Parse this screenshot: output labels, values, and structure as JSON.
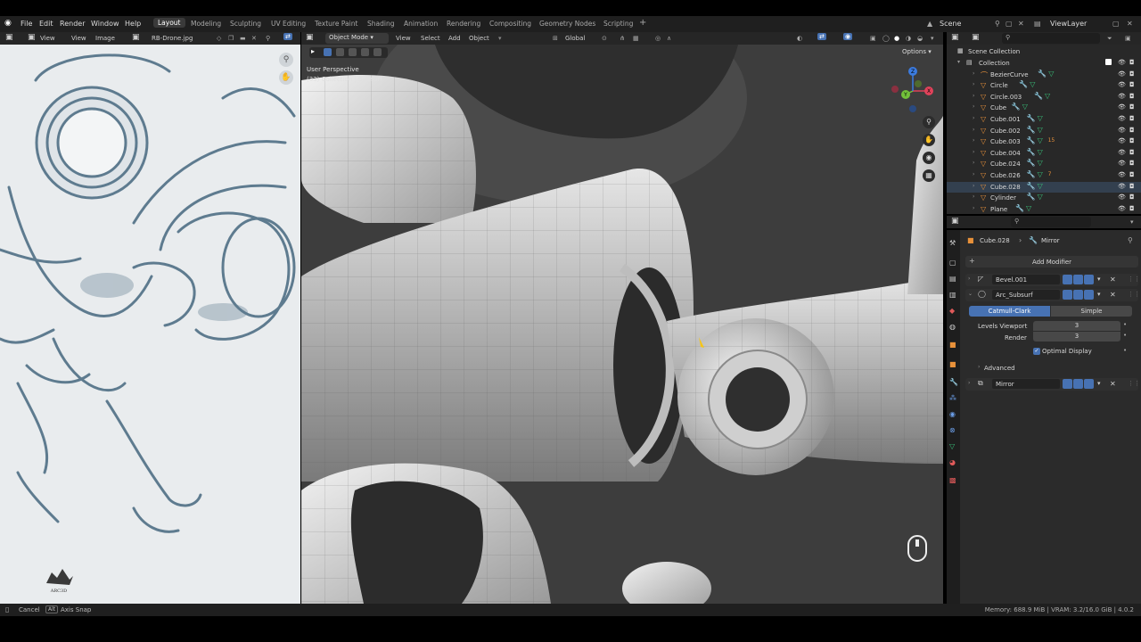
{
  "menubar": {
    "items": [
      "File",
      "Edit",
      "Render",
      "Window",
      "Help"
    ],
    "workspaces": [
      "Layout",
      "Modeling",
      "Sculpting",
      "UV Editing",
      "Texture Paint",
      "Shading",
      "Animation",
      "Rendering",
      "Compositing",
      "Geometry Nodes",
      "Scripting"
    ],
    "active_workspace": "Layout",
    "scene_label": "Scene",
    "view_layer_label": "ViewLayer"
  },
  "image_editor": {
    "view_label": "View",
    "menu": [
      "View",
      "Image"
    ],
    "image_name": "RB-Drone.jpg",
    "logo_text": "ARC3D"
  },
  "viewport": {
    "mode": "Object Mode",
    "menu": [
      "View",
      "Select",
      "Add",
      "Object"
    ],
    "transform_orientation": "Global",
    "options_label": "Options",
    "perspective_label": "User Perspective",
    "collection_info": "(33) Collection | Subsurf",
    "gizmo_axes": [
      "X",
      "Y",
      "Z"
    ]
  },
  "outliner": {
    "scene_collection": "Scene Collection",
    "collection": "Collection",
    "items": [
      {
        "name": "BezierCurve",
        "type": "curve"
      },
      {
        "name": "Circle",
        "type": "mesh"
      },
      {
        "name": "Circle.003",
        "type": "mesh"
      },
      {
        "name": "Cube",
        "type": "mesh"
      },
      {
        "name": "Cube.001",
        "type": "mesh"
      },
      {
        "name": "Cube.002",
        "type": "mesh"
      },
      {
        "name": "Cube.003",
        "type": "mesh",
        "badge": "15"
      },
      {
        "name": "Cube.004",
        "type": "mesh"
      },
      {
        "name": "Cube.024",
        "type": "mesh"
      },
      {
        "name": "Cube.026",
        "type": "mesh",
        "badge": "7"
      },
      {
        "name": "Cube.028",
        "type": "mesh",
        "selected": true
      },
      {
        "name": "Cylinder",
        "type": "mesh"
      },
      {
        "name": "Plane",
        "type": "mesh"
      }
    ]
  },
  "properties": {
    "object_name": "Cube.028",
    "modifier_context": "Mirror",
    "add_modifier_label": "Add Modifier",
    "modifiers": [
      {
        "name": "Bevel.001",
        "expanded": false
      },
      {
        "name": "Arc_Subsurf",
        "expanded": true
      },
      {
        "name": "Mirror",
        "expanded": false
      }
    ],
    "subsurf": {
      "catmull_label": "Catmull-Clark",
      "simple_label": "Simple",
      "levels_viewport_label": "Levels Viewport",
      "levels_viewport_value": "3",
      "render_label": "Render",
      "render_value": "3",
      "optimal_display_label": "Optimal Display",
      "advanced_label": "Advanced"
    }
  },
  "statusbar": {
    "cancel_label": "Cancel",
    "alt_key": "Alt",
    "axis_snap_label": "Axis Snap",
    "memory": "Memory: 688.9 MiB | VRAM: 3.2/16.0 GiB | 4.0.2"
  },
  "colors": {
    "accent": "#4772b3",
    "object_orange": "#e8913a",
    "mesh_green": "#39c07a",
    "modifier_blue": "#6b9ee8"
  }
}
